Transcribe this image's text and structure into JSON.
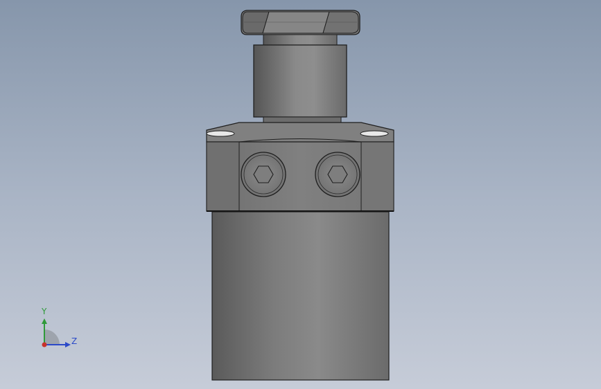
{
  "viewport": {
    "background_top": "#8696ab",
    "background_bottom": "#c6ccd8"
  },
  "model": {
    "description_icon": "cylinder-valve-part",
    "bolts": [
      "socket-head-cap-screw",
      "socket-head-cap-screw"
    ]
  },
  "triad": {
    "y_label": "Y",
    "z_label": "Z",
    "colors": {
      "y": "#2f9a3a",
      "z": "#2b49c8",
      "x": "#c8322b"
    }
  }
}
